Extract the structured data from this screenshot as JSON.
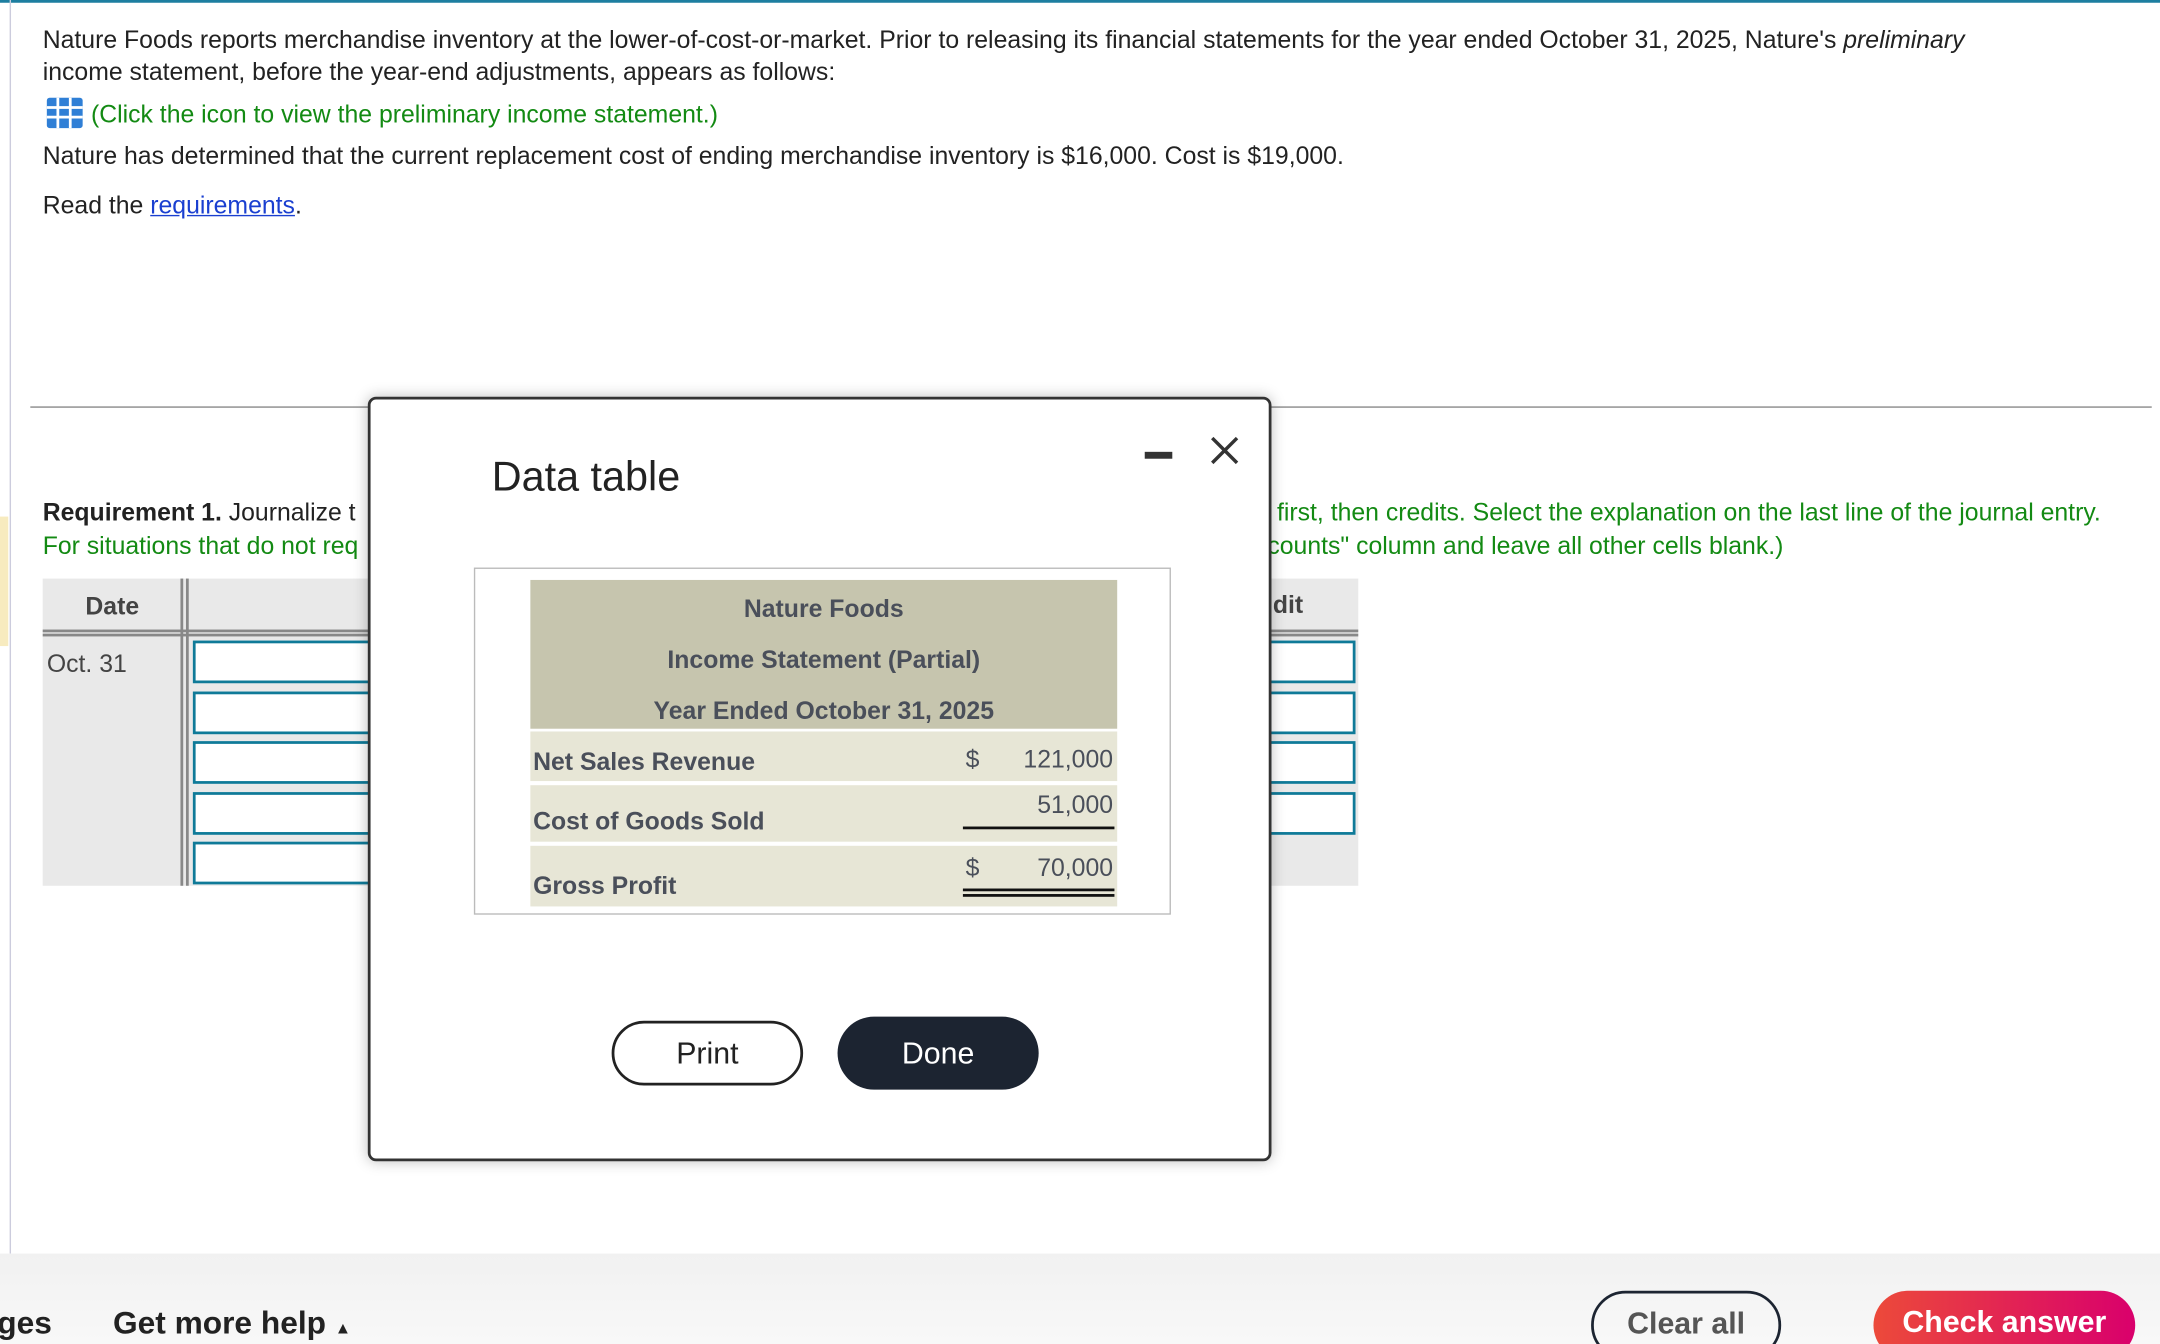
{
  "problem": {
    "intro_a": "Nature Foods reports merchandise inventory at the lower-of-cost-or-market. Prior to releasing its financial statements for the year ended October 31, 2025, Nature's ",
    "intro_italic": "preliminary",
    "intro_b": "income statement, before the year-end adjustments, appears as follows:",
    "icon_link": "(Click the icon to view the preliminary income statement.)",
    "replacement": "Nature has determined that the current replacement cost of ending merchandise inventory is $16,000. Cost is $19,000.",
    "read_prefix": "Read the ",
    "read_link": "requirements",
    "read_suffix": "."
  },
  "requirement": {
    "label": "Requirement 1.",
    "text_left": " Journalize t",
    "green_left": "For situations that do not req",
    "text_right": "first, then credits. Select the explanation on the last line of the journal entry.",
    "green_right": "counts\" column and leave all other cells blank.)"
  },
  "journal": {
    "date_header": "Date",
    "credit_header_partial": "dit",
    "date_value": "Oct. 31"
  },
  "modal": {
    "title": "Data table",
    "company": "Nature Foods",
    "statement": "Income Statement (Partial)",
    "period": "Year Ended October 31, 2025",
    "rows": [
      {
        "label": "Net Sales Revenue",
        "symbol": "$",
        "amount": "121,000"
      },
      {
        "label": "Cost of Goods Sold",
        "symbol": "",
        "amount": "51,000"
      },
      {
        "label": "Gross Profit",
        "symbol": "$",
        "amount": "70,000"
      }
    ],
    "print_label": "Print",
    "done_label": "Done"
  },
  "footer": {
    "left_partial": "ges",
    "help": "Get more help",
    "clear": "Clear all",
    "check": "Check answer"
  },
  "colors": {
    "accent_green": "#138a13",
    "input_border": "#0f7a98",
    "done_bg": "#1c2431"
  }
}
